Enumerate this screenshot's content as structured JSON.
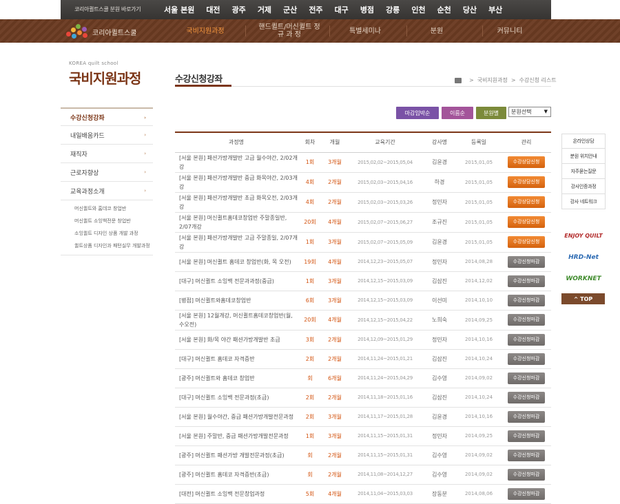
{
  "topbar": {
    "go_label": "코리아퀼트스쿨 분원 바로가기",
    "branches": [
      "서울 본원",
      "대전",
      "광주",
      "거제",
      "군산",
      "전주",
      "대구",
      "병점",
      "강릉",
      "인천",
      "순천",
      "당산",
      "부산"
    ]
  },
  "nav": {
    "brand": "코리아퀼트스쿨",
    "items": [
      {
        "label": "국비지원과정"
      },
      {
        "label": "핸드퀼트/머신퀼트 정 규 과 정"
      },
      {
        "label": "특별세미나"
      },
      {
        "label": "분원"
      },
      {
        "label": "커뮤니티"
      }
    ]
  },
  "left": {
    "title_en": "KOREA quilt school",
    "title_kr": "국비지원과정",
    "menu": [
      {
        "label": "수강신청강좌",
        "arrow": "›"
      },
      {
        "label": "내일배움카드",
        "arrow": "›"
      },
      {
        "label": "재직자",
        "arrow": "›"
      },
      {
        "label": "근로자향상",
        "arrow": "›"
      },
      {
        "label": "교육과정소개",
        "arrow": "›"
      }
    ],
    "submenu": [
      "머신퀼트와 홈데코 창업반",
      "머신퀼트 소잉백전문 창업반",
      "소잉퀼트 디자인 상품 개발 과정",
      "퀼트상품 디자인과 패턴실무 개발과정"
    ]
  },
  "main": {
    "page_title": "수강신청강좌",
    "breadcrumb": [
      "국비지원과정",
      "수강신청 리스트"
    ],
    "filters": {
      "sort_deadline": "마감임박순",
      "sort_name": "이름순",
      "sort_branch": "분원별",
      "branch_select": "분원선택"
    },
    "table": {
      "headers": [
        "과정명",
        "회차",
        "개월",
        "교육기간",
        "강사명",
        "등록일",
        "관리"
      ],
      "rows": [
        {
          "title": "[서울 본원] 패션가방개발반 고급 월수야간, 2/02개강",
          "round": "1회",
          "months": "3개월",
          "period": "2015,02,02~2015,05,04",
          "teacher": "김윤경",
          "date": "2015,01,05",
          "action": "수강상담신청",
          "status": "open"
        },
        {
          "title": "[서울 본원] 패션가방개발반 중급 화목야간, 2/03개강",
          "round": "4회",
          "months": "2개월",
          "period": "2015,02,03~2015,04,16",
          "teacher": "하경",
          "date": "2015,01,05",
          "action": "수강상담신청",
          "status": "open"
        },
        {
          "title": "[서울 본원] 패션가방개발반 초급 화목오전, 2/03개강",
          "round": "4회",
          "months": "2개월",
          "period": "2015,02,03~2015,03,26",
          "teacher": "정민자",
          "date": "2015,01,05",
          "action": "수강상담신청",
          "status": "open"
        },
        {
          "title": "[서울 본원] 머신퀼트홈데코창업반 주말종일반, 2/07개강",
          "round": "20회",
          "months": "4개월",
          "period": "2015,02,07~2015,06,27",
          "teacher": "조규진",
          "date": "2015,01,05",
          "action": "수강상담신청",
          "status": "open"
        },
        {
          "title": "[서울 본원] 패션가방개발반 고급 주말종일, 2/07개강",
          "round": "1회",
          "months": "3개월",
          "period": "2015,02,07~2015,05,09",
          "teacher": "김윤경",
          "date": "2015,01,05",
          "action": "수강상담신청",
          "status": "open"
        },
        {
          "title": "[서울 본원] 머신퀼트 홈데코 창업반(화, 목 오전)",
          "round": "19회",
          "months": "4개월",
          "period": "2014,12,23~2015,05,07",
          "teacher": "정민자",
          "date": "2014,08,28",
          "action": "수강신청마감",
          "status": "closed"
        },
        {
          "title": "[대구] 머신퀼트 소잉백 전문과과정(중급)",
          "round": "1회",
          "months": "3개월",
          "period": "2014,12,15~2015,03,09",
          "teacher": "김삼진",
          "date": "2014,12,02",
          "action": "수강신청마감",
          "status": "closed"
        },
        {
          "title": "[병점] 머신퀼트와홈데코창업반",
          "round": "6회",
          "months": "3개월",
          "period": "2014,12,15~2015,03,09",
          "teacher": "이선미",
          "date": "2014,10,10",
          "action": "수강신청마감",
          "status": "closed"
        },
        {
          "title": "[서울 본원] 12월개강, 머신퀼트홈데코창업반(월,수오전)",
          "round": "20회",
          "months": "4개월",
          "period": "2014,12,15~2015,04,22",
          "teacher": "노희숙",
          "date": "2014,09,25",
          "action": "수강신청마감",
          "status": "closed"
        },
        {
          "title": "[서울 본원] 화/목 야간 패션가방개발반 초급",
          "round": "3회",
          "months": "2개월",
          "period": "2014,12,09~2015,01,29",
          "teacher": "정민자",
          "date": "2014,10,16",
          "action": "수강신청마감",
          "status": "closed"
        },
        {
          "title": "[대구] 머신퀼트 홈데코 자격증반",
          "round": "2회",
          "months": "2개월",
          "period": "2014,11,24~2015,01,21",
          "teacher": "김삼진",
          "date": "2014,10,24",
          "action": "수강신청마감",
          "status": "closed"
        },
        {
          "title": "[광주] 머신퀼트와 홈데코 창업반",
          "round": "회",
          "months": "6개월",
          "period": "2014,11,24~2015,04,29",
          "teacher": "김수영",
          "date": "2014,09,02",
          "action": "수강신청마감",
          "status": "closed"
        },
        {
          "title": "[대구] 머신퀼트 소잉백 전문과정(초급)",
          "round": "2회",
          "months": "2개월",
          "period": "2014,11,18~2015,01,16",
          "teacher": "김삼진",
          "date": "2014,10,24",
          "action": "수강신청마감",
          "status": "closed"
        },
        {
          "title": "[서울 본원] 월수야간, 중급 패션가방개발전문과정",
          "round": "2회",
          "months": "3개월",
          "period": "2014,11,17~2015,01,28",
          "teacher": "김윤경",
          "date": "2014,10,16",
          "action": "수강신청마감",
          "status": "closed"
        },
        {
          "title": "[서울 본원] 주말반, 중급 패션가방개발전문과정",
          "round": "1회",
          "months": "3개월",
          "period": "2014,11,15~2015,01,31",
          "teacher": "정민자",
          "date": "2014,09,25",
          "action": "수강신청마감",
          "status": "closed"
        },
        {
          "title": "[광주] 머신퀼트 패션가방 개발전문과정(초급)",
          "round": "회",
          "months": "2개월",
          "period": "2014,11,15~2015,01,31",
          "teacher": "김수영",
          "date": "2014,09,02",
          "action": "수강신청마감",
          "status": "closed"
        },
        {
          "title": "[광주] 머신퀼트 홈데코 자격증반(초급)",
          "round": "회",
          "months": "2개월",
          "period": "2014,11,08~2014,12,27",
          "teacher": "김수영",
          "date": "2014,09,02",
          "action": "수강신청마감",
          "status": "closed"
        },
        {
          "title": "[대전] 머신퀼트 소잉백 전문창업과정",
          "round": "5회",
          "months": "4개월",
          "period": "2014,11,04~2015,03,03",
          "teacher": "장동분",
          "date": "2014,08,06",
          "action": "수강신청마감",
          "status": "closed"
        }
      ]
    }
  },
  "quick": {
    "links": [
      "온라인상담",
      "분원 위치안내",
      "자주묻는질문",
      "강사인증과정",
      "강사 네트워크"
    ],
    "banners": [
      "ENJOY QUILT",
      "HRD-Net",
      "WORKNET"
    ],
    "top": "^ TOP"
  }
}
